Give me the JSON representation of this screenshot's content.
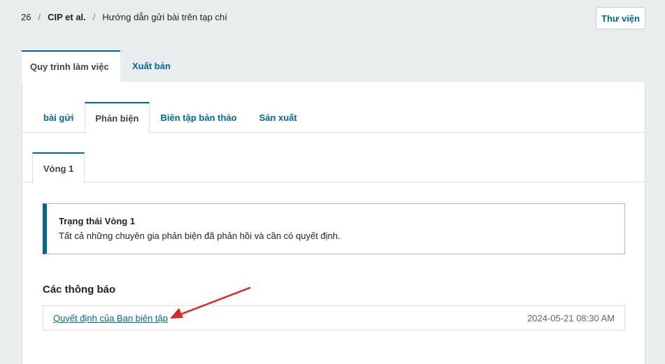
{
  "breadcrumb": {
    "id": "26",
    "author": "CIP et al.",
    "title": "Hướng dẫn gửi bài trên tạp chí"
  },
  "header": {
    "library_label": "Thư viện"
  },
  "main_tabs": [
    {
      "label": "Quy trình làm việc"
    },
    {
      "label": "Xuất bản"
    }
  ],
  "sub_tabs": [
    {
      "label": "bài gửi"
    },
    {
      "label": "Phản biện"
    },
    {
      "label": "Biên tập bản thảo"
    },
    {
      "label": "Sản xuất"
    }
  ],
  "round_tabs": [
    {
      "label": "Vòng 1"
    }
  ],
  "status": {
    "title": "Trạng thái Vòng 1",
    "text": "Tất cả những chuyên gia phản biện đã phản hồi và cần có quyết định."
  },
  "notifications": {
    "heading": "Các thông báo",
    "items": [
      {
        "label": "Quyết định của Ban biên tập",
        "date": "2024-05-21 08:30 AM"
      }
    ]
  },
  "colors": {
    "accent": "#006798",
    "annotation_arrow": "#e02424"
  }
}
